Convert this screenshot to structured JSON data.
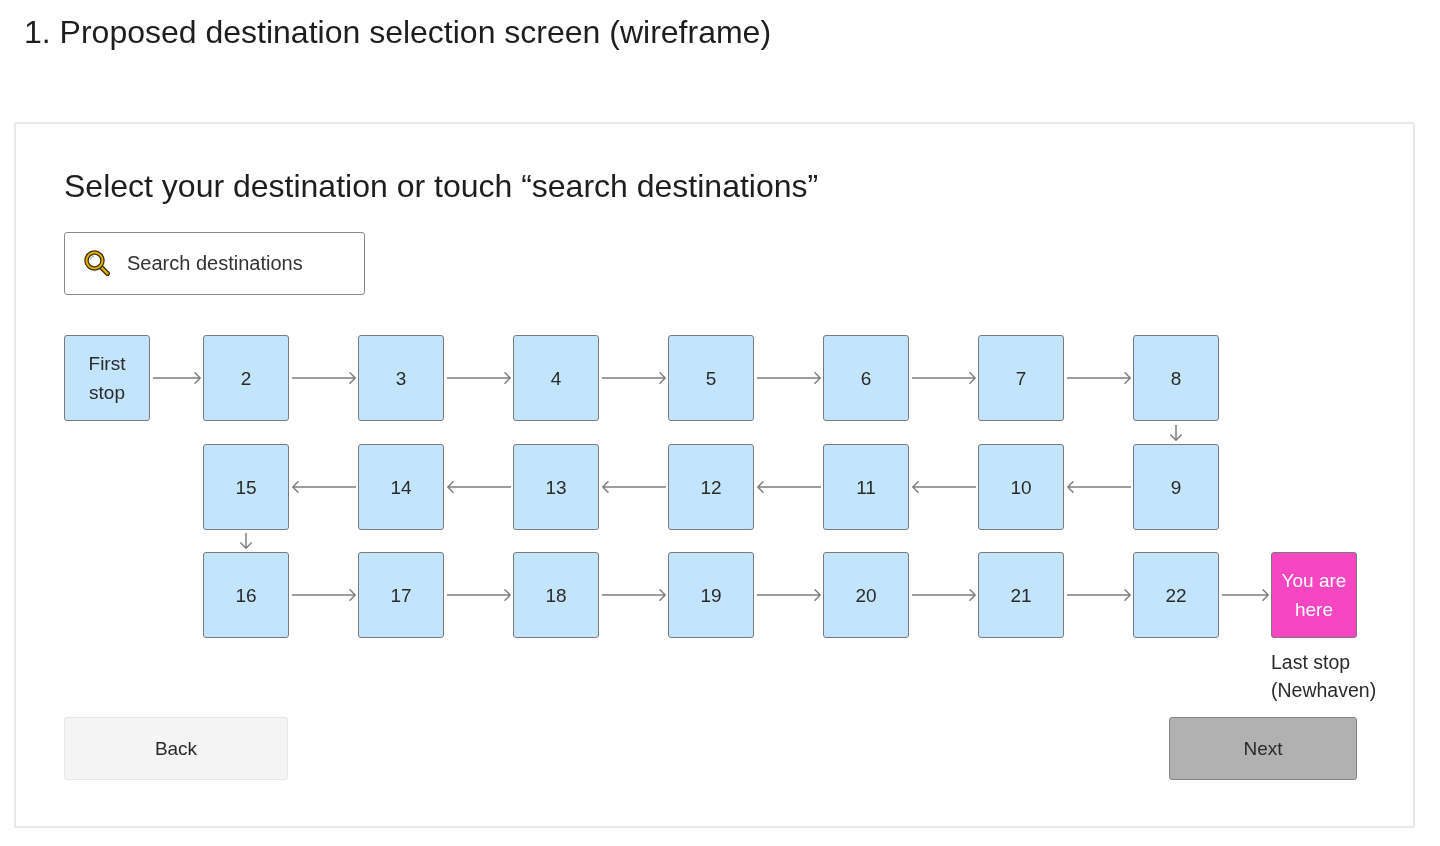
{
  "page_title": "1. Proposed destination selection screen (wireframe)",
  "screen": {
    "heading": "Select your destination or touch “search destinations”",
    "search": {
      "placeholder": "Search destinations"
    },
    "route": {
      "rows": [
        {
          "reversed": false,
          "stops": [
            {
              "label": "First stop",
              "current": false
            },
            {
              "label": "2",
              "current": false
            },
            {
              "label": "3",
              "current": false
            },
            {
              "label": "4",
              "current": false
            },
            {
              "label": "5",
              "current": false
            },
            {
              "label": "6",
              "current": false
            },
            {
              "label": "7",
              "current": false
            },
            {
              "label": "8",
              "current": false
            }
          ]
        },
        {
          "reversed": true,
          "stops": [
            {
              "label": "15",
              "current": false
            },
            {
              "label": "14",
              "current": false
            },
            {
              "label": "13",
              "current": false
            },
            {
              "label": "12",
              "current": false
            },
            {
              "label": "11",
              "current": false
            },
            {
              "label": "10",
              "current": false
            },
            {
              "label": "9",
              "current": false
            }
          ]
        },
        {
          "reversed": false,
          "stops": [
            {
              "label": "16",
              "current": false
            },
            {
              "label": "17",
              "current": false
            },
            {
              "label": "18",
              "current": false
            },
            {
              "label": "19",
              "current": false
            },
            {
              "label": "20",
              "current": false
            },
            {
              "label": "21",
              "current": false
            },
            {
              "label": "22",
              "current": false
            },
            {
              "label": "You are here",
              "current": true,
              "caption": "Last stop (Newhaven)"
            }
          ]
        }
      ]
    },
    "buttons": [
      {
        "label": "Back",
        "kind": "secondary"
      },
      {
        "label": "Next",
        "kind": "primary"
      }
    ]
  }
}
